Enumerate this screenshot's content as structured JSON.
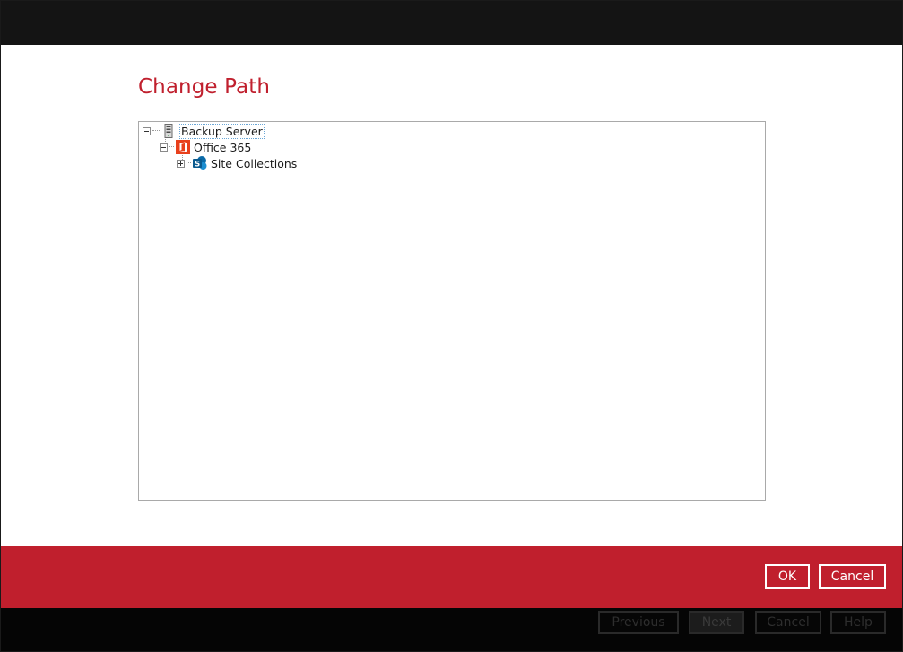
{
  "dialog": {
    "title": "Change Path"
  },
  "tree": {
    "nodes": [
      {
        "label": "Backup Server",
        "icon": "server-icon",
        "expanded": true,
        "selected": true
      },
      {
        "label": "Office 365",
        "icon": "office365-icon",
        "expanded": true
      },
      {
        "label": "Site Collections",
        "icon": "sharepoint-icon",
        "expanded": false
      }
    ]
  },
  "footer": {
    "ok_label": "OK",
    "cancel_label": "Cancel"
  },
  "background_wizard": {
    "previous_label": "Previous",
    "next_label": "Next",
    "cancel_label": "Cancel",
    "help_label": "Help"
  },
  "colors": {
    "accent_red": "#c01f2d",
    "title_red": "#c0202e",
    "top_bar": "#141414"
  }
}
